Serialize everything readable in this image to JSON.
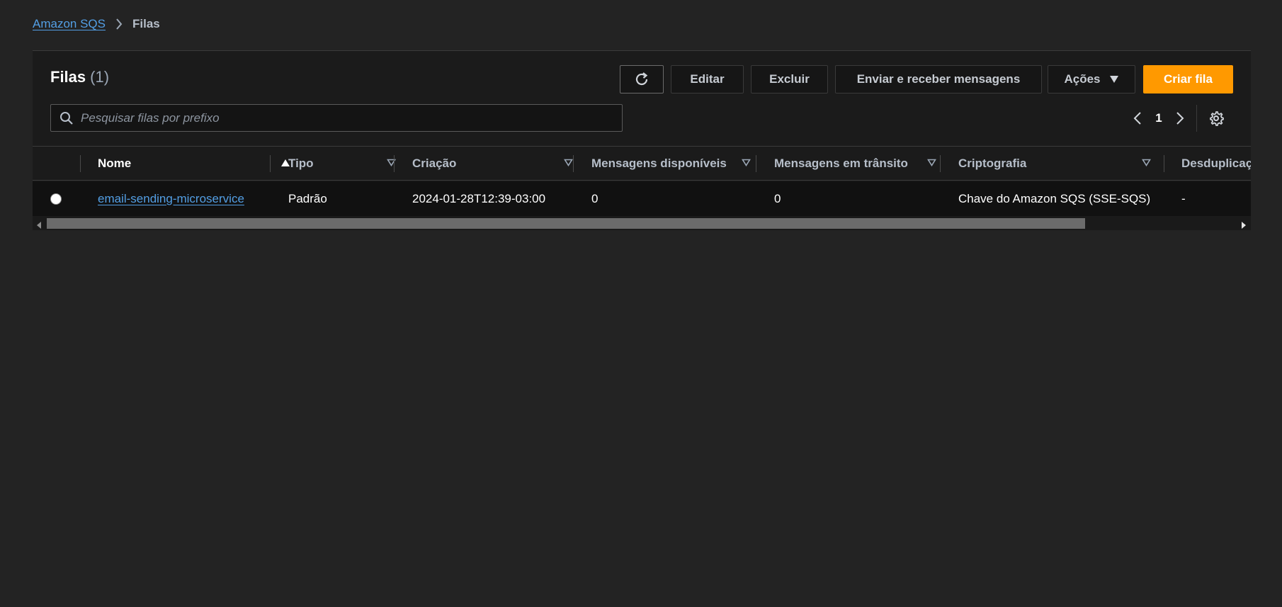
{
  "breadcrumb": {
    "root": "Amazon SQS",
    "current": "Filas"
  },
  "panel": {
    "title": "Filas",
    "count": "(1)"
  },
  "toolbar": {
    "edit_label": "Editar",
    "delete_label": "Excluir",
    "send_label": "Enviar e receber mensagens",
    "actions_label": "Ações",
    "create_label": "Criar fila"
  },
  "search": {
    "placeholder": "Pesquisar filas por prefixo",
    "value": ""
  },
  "pagination": {
    "current_page": "1"
  },
  "table": {
    "columns": {
      "name": "Nome",
      "type": "Tipo",
      "created": "Criação",
      "available": "Mensagens disponíveis",
      "in_transit": "Mensagens em trânsito",
      "encryption": "Criptografia",
      "dedup": "Desduplicaç"
    },
    "rows": [
      {
        "name": "email-sending-microservice",
        "type": "Padrão",
        "created": "2024-01-28T12:39-03:00",
        "available": "0",
        "in_transit": "0",
        "encryption": "Chave do Amazon SQS (SSE-SQS)",
        "dedup": "-"
      }
    ]
  },
  "colors": {
    "background": "#232323",
    "panel": "#1b1b1b",
    "link": "#539fe5",
    "primary": "#ff9900"
  },
  "icons": {
    "breadcrumb_separator": "chevron-right-icon",
    "refresh": "refresh-icon",
    "actions_caret": "caret-down-icon",
    "search": "search-icon",
    "prev": "chevron-left-icon",
    "next": "chevron-right-icon",
    "settings": "gear-icon"
  }
}
